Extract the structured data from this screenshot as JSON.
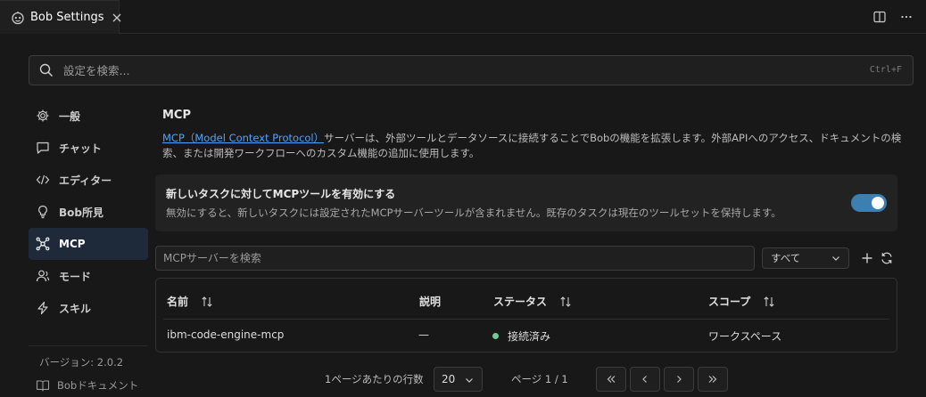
{
  "tab": {
    "title": "Bob Settings"
  },
  "search": {
    "placeholder": "設定を検索...",
    "shortcut": "Ctrl+F"
  },
  "sidebar": {
    "items": [
      {
        "label": "一般",
        "icon": "gear-icon"
      },
      {
        "label": "チャット",
        "icon": "chat-icon"
      },
      {
        "label": "エディター",
        "icon": "code-icon"
      },
      {
        "label": "Bob所見",
        "icon": "lightbulb-icon"
      },
      {
        "label": "MCP",
        "icon": "mcp-icon",
        "active": true
      },
      {
        "label": "モード",
        "icon": "person-icon"
      },
      {
        "label": "スキル",
        "icon": "bolt-icon"
      }
    ],
    "version": "バージョン: 2.0.2",
    "docs_label": "Bobドキュメント"
  },
  "main": {
    "title": "MCP",
    "desc_link": "MCP（Model Context Protocol）",
    "desc_rest": "サーバーは、外部ツールとデータソースに接続することでBobの機能を拡張します。外部APIへのアクセス、ドキュメントの検索、または開発ワークフローへのカスタム機能の追加に使用します。",
    "toggle": {
      "title": "新しいタスクに対してMCPツールを有効にする",
      "description": "無効にすると、新しいタスクには設定されたMCPサーバーツールが含まれません。既存のタスクは現在のツールセットを保持します。",
      "enabled": true,
      "color": "#3c7fb1"
    },
    "filter": {
      "placeholder": "MCPサーバーを検索",
      "select_value": "すべて"
    },
    "table": {
      "headers": {
        "name": "名前",
        "description": "説明",
        "status": "ステータス",
        "scope": "スコープ"
      },
      "rows": [
        {
          "name": "ibm-code-engine-mcp",
          "description": "—",
          "status": "接続済み",
          "status_color": "#73c991",
          "scope": "ワークスペース"
        }
      ]
    },
    "pagination": {
      "rows_label": "1ページあたりの行数",
      "page_size": "20",
      "page_info": "ページ 1 / 1"
    }
  }
}
